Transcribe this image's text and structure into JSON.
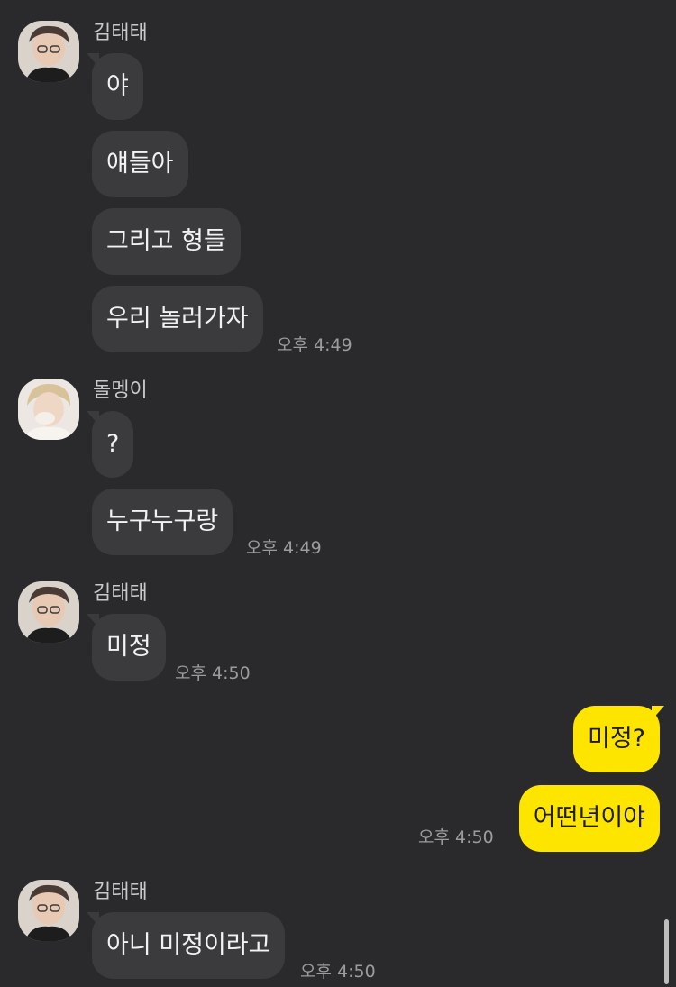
{
  "messages": {
    "group1": {
      "sender": "김태태",
      "bubbles": [
        "야",
        "얘들아",
        "그리고 형들",
        "우리 놀러가자"
      ],
      "time": "오후 4:49"
    },
    "group2": {
      "sender": "돌멩이",
      "bubbles": [
        "?",
        "누구누구랑"
      ],
      "time": "오후 4:49"
    },
    "group3": {
      "sender": "김태태",
      "bubbles": [
        "미정"
      ],
      "time": "오후 4:50"
    },
    "group4_mine": {
      "bubbles": [
        "미정?",
        "어떤년이야"
      ],
      "time": "오후 4:50"
    },
    "group5": {
      "sender": "김태태",
      "bubbles": [
        "아니 미정이라고"
      ],
      "time": "오후 4:50"
    }
  },
  "colors": {
    "background": "#2a2a2c",
    "incoming_bubble": "#3b3b3e",
    "outgoing_bubble": "#fde500"
  }
}
